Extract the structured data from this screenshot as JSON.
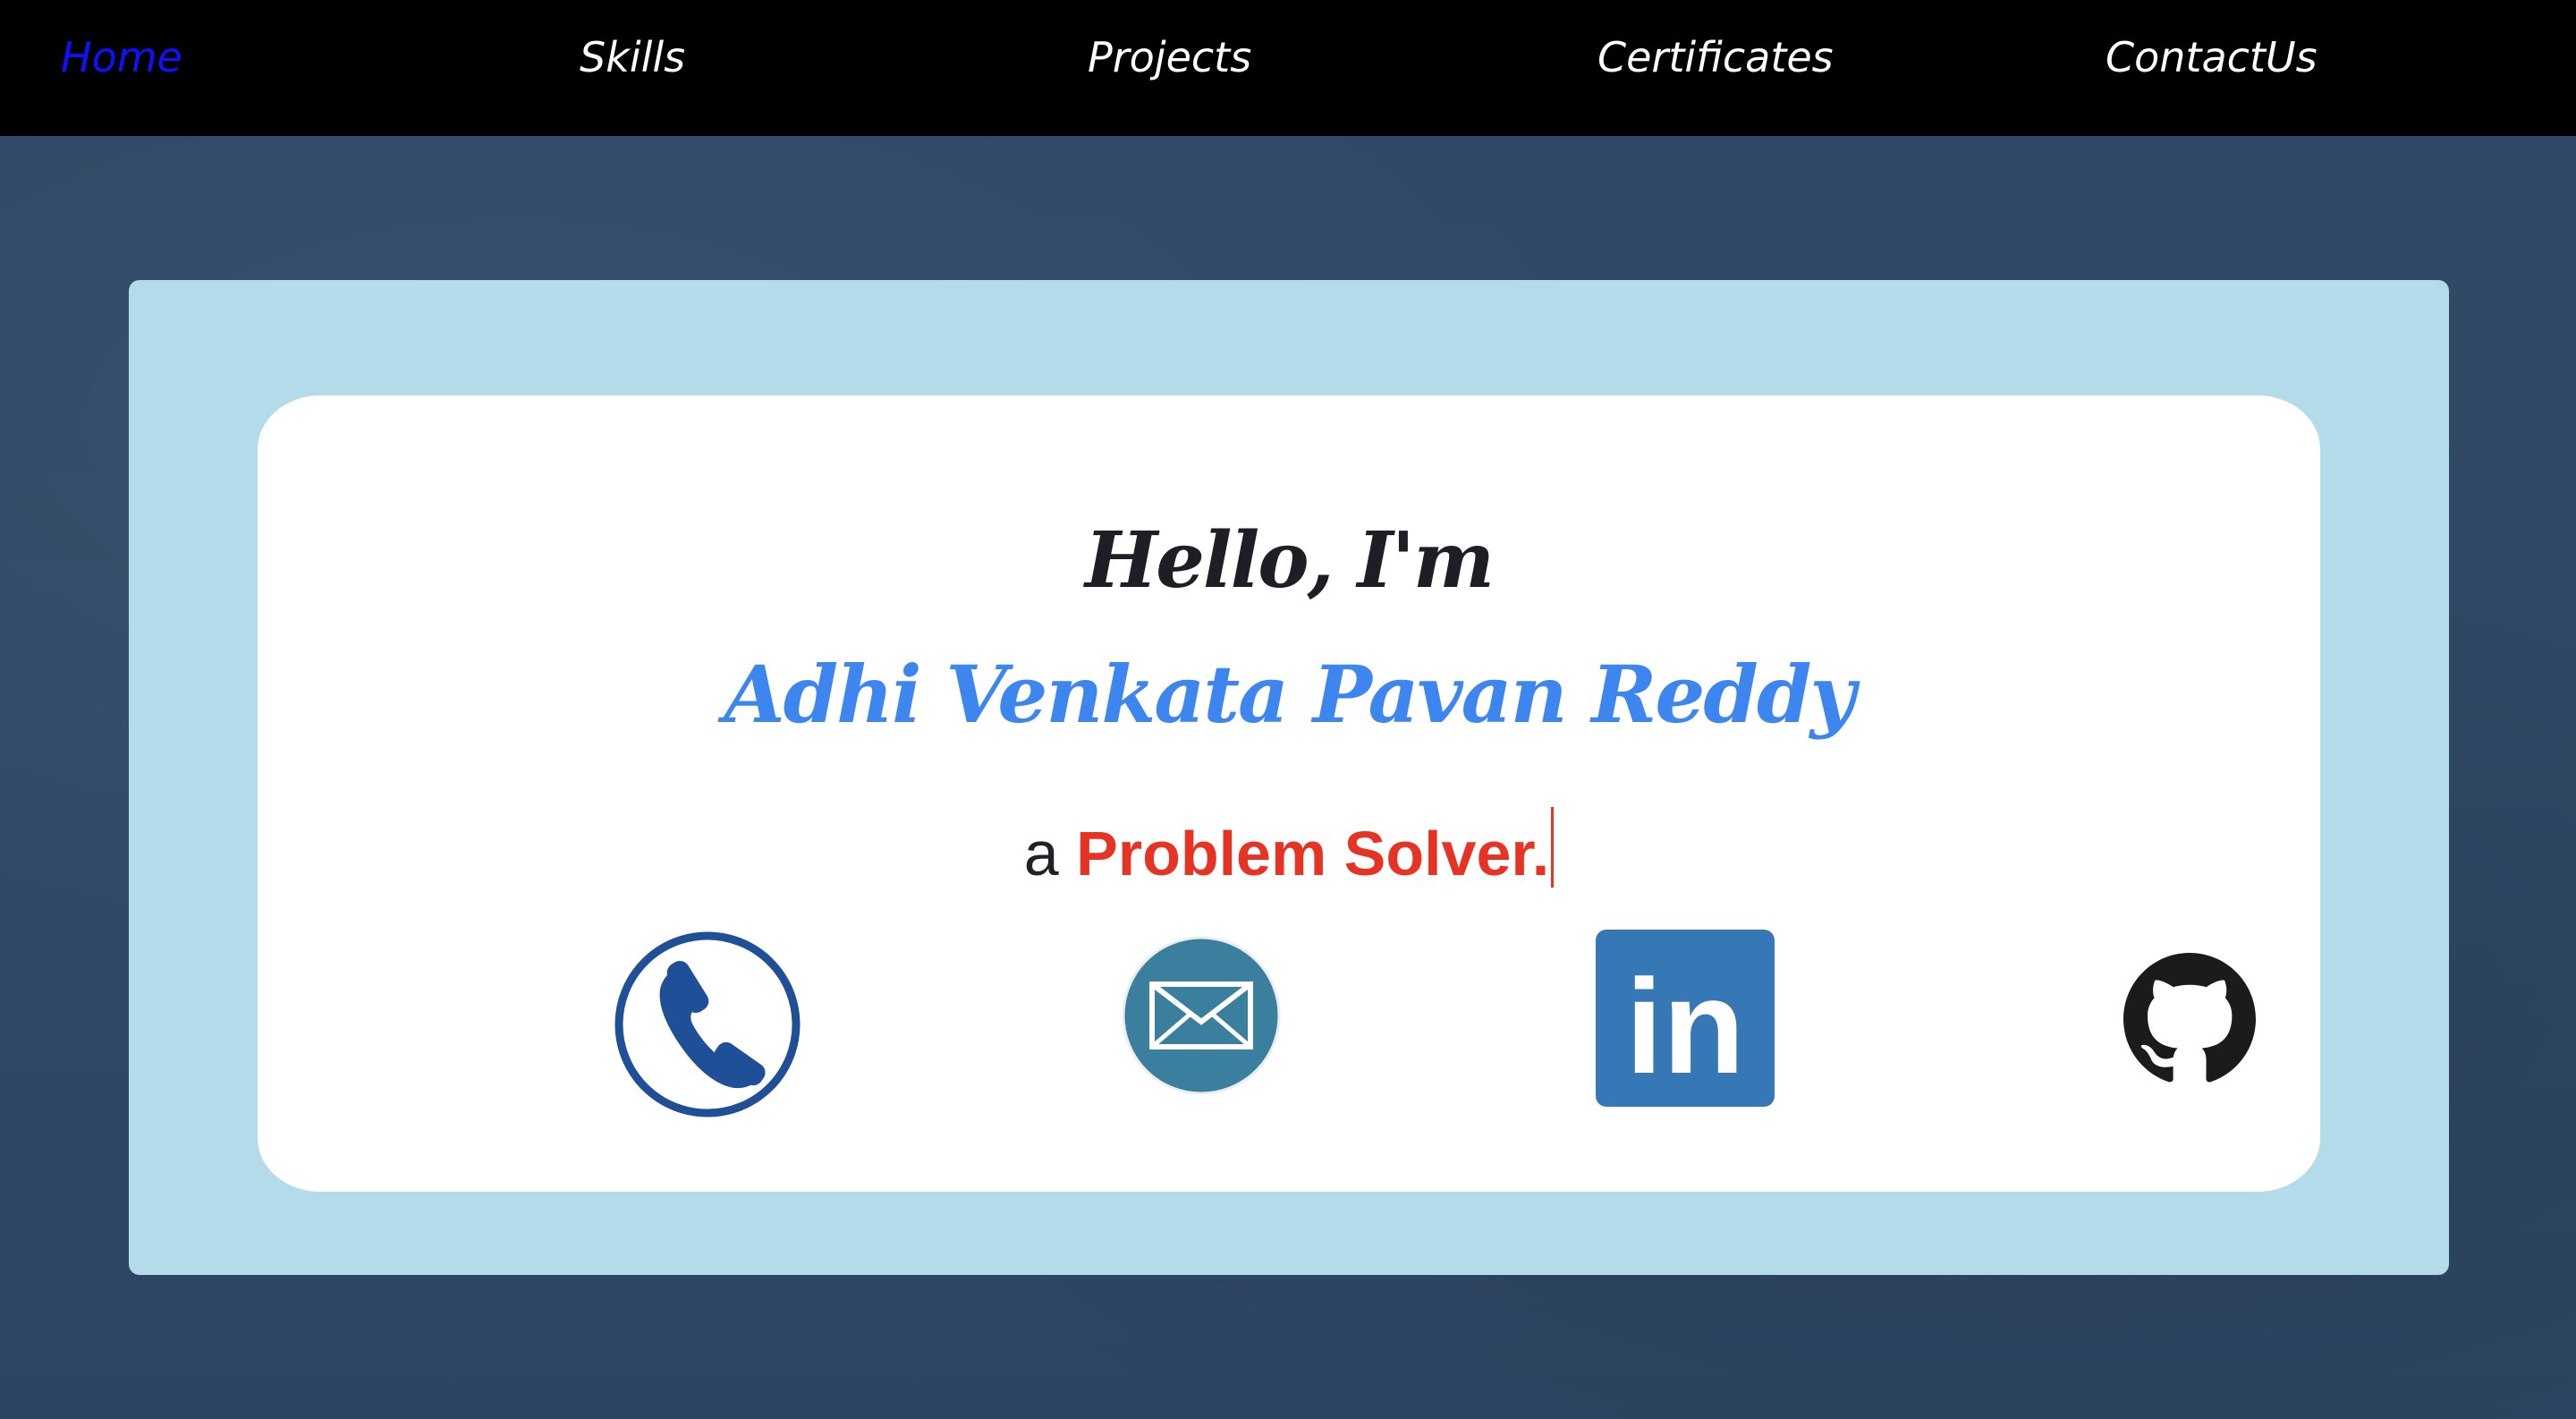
{
  "nav": {
    "items": [
      {
        "label": "Home",
        "active": true
      },
      {
        "label": "Skills",
        "active": false
      },
      {
        "label": "Projects",
        "active": false
      },
      {
        "label": "Certificates",
        "active": false
      },
      {
        "label": "ContactUs",
        "active": false
      }
    ]
  },
  "hero": {
    "greeting": "Hello, I'm",
    "name": "Adhi Venkata Pavan Reddy",
    "tagline_prefix": "a",
    "tagline_role": "Problem Solver."
  },
  "social": {
    "icons": [
      "phone-icon",
      "email-icon",
      "linkedin-icon",
      "github-icon"
    ],
    "linkedin_text": "in"
  },
  "colors": {
    "nav_background": "#000000",
    "nav_link": "#ffffff",
    "nav_active": "#1010ff",
    "page_background": "#2f4866",
    "outer_panel": "#b3dbe9",
    "card": "#ffffff",
    "greeting": "#1d1f24",
    "name": "#3d86f0",
    "role": "#e53423",
    "phone": "#1f4f96",
    "email": "#3a7f9e",
    "linkedin": "#3578b5",
    "github": "#1b1b1b"
  }
}
